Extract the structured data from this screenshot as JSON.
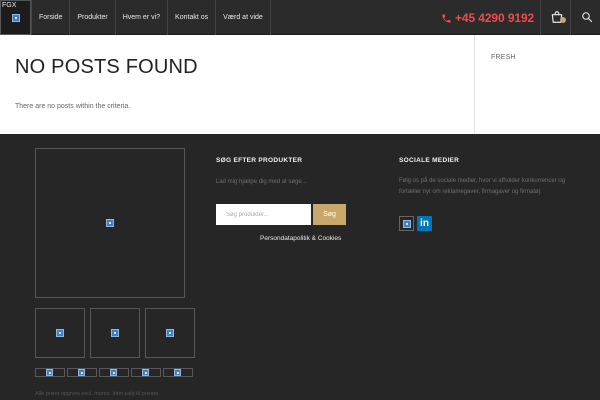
{
  "header": {
    "logo_text": "FGX",
    "nav": [
      {
        "label": "Forside"
      },
      {
        "label": "Produkter"
      },
      {
        "label": "Hvem er vi?"
      },
      {
        "label": "Kontakt os"
      },
      {
        "label": "Værd at vide"
      }
    ],
    "phone": "+45 4290 9192",
    "phone_icon": "phone-icon",
    "cart_icon": "shopping-bag-icon",
    "search_icon": "search-icon",
    "accent_color": "#c8a76a",
    "phone_color": "#ef4b4b"
  },
  "main": {
    "title": "NO POSTS FOUND",
    "message": "There are no posts within the criteria.",
    "sidebar_label": "FRESH"
  },
  "footer": {
    "search": {
      "heading": "SØG EFTER PRODUKTER",
      "intro": "Lad mig hjælpe dig med at søge...",
      "placeholder": "Søg produkter...",
      "button_label": "Søg",
      "privacy_link": "Persondatapolitik & Cookies"
    },
    "social": {
      "heading": "SOCIALE MEDIER",
      "text": "Følg os på de sociale medier, hvor vi afholder konkurrencer og fortæller nyt om reklamegaver, firmagaver og firmatøj.",
      "linkedin_label": "in"
    },
    "fine_print": "Alle priser opgives excl. moms. Intet salg til private."
  }
}
